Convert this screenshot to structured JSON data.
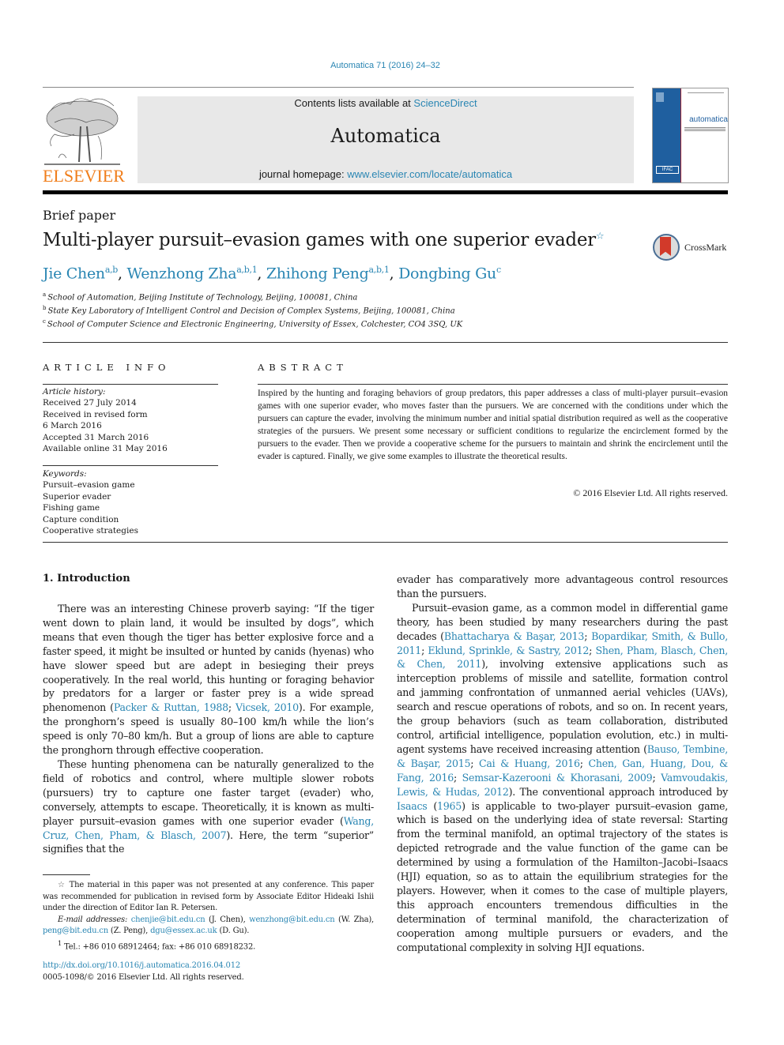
{
  "header": {
    "journal_ref": "Automatica 71 (2016) 24–32",
    "contents_prefix": "Contents lists available at ",
    "contents_link": "ScienceDirect",
    "journal_title": "Automatica",
    "homepage_prefix": "journal homepage: ",
    "homepage_link": "www.elsevier.com/locate/automatica",
    "publisher_logo_text": "ELSEVIER",
    "cover_title": "automatica",
    "cover_badge": "IFAC"
  },
  "article": {
    "type": "Brief paper",
    "title": "Multi-player pursuit–evasion games with one superior evader",
    "title_note_mark": "☆",
    "crossmark_label": "CrossMark",
    "authors": [
      {
        "name": "Jie Chen",
        "sup": "a,b"
      },
      {
        "name": "Wenzhong Zha",
        "sup": "a,b,1"
      },
      {
        "name": "Zhihong Peng",
        "sup": "a,b,1"
      },
      {
        "name": "Dongbing Gu",
        "sup": "c"
      }
    ],
    "affiliations": [
      {
        "mark": "a",
        "text": "School of Automation, Beijing Institute of Technology, Beijing, 100081, China"
      },
      {
        "mark": "b",
        "text": "State Key Laboratory of Intelligent Control and Decision of Complex Systems, Beijing, 100081, China"
      },
      {
        "mark": "c",
        "text": "School of Computer Science and Electronic Engineering, University of Essex, Colchester, CO4 3SQ, UK"
      }
    ]
  },
  "article_info": {
    "heading": "ARTICLE INFO",
    "history_label": "Article history:",
    "history": [
      "Received 27 July 2014",
      "Received in revised form",
      "6 March 2016",
      "Accepted 31 March 2016",
      "Available online 31 May 2016"
    ],
    "keywords_label": "Keywords:",
    "keywords": [
      "Pursuit–evasion game",
      "Superior evader",
      "Fishing game",
      "Capture condition",
      "Cooperative strategies"
    ]
  },
  "abstract": {
    "heading": "ABSTRACT",
    "text": "Inspired by the hunting and foraging behaviors of group predators, this paper addresses a class of multi-player pursuit–evasion games with one superior evader, who moves faster than the pursuers. We are concerned with the conditions under which the pursuers can capture the evader, involving the minimum number and initial spatial distribution required as well as the cooperative strategies of the pursuers. We present some necessary or sufficient conditions to regularize the encirclement formed by the pursuers to the evader. Then we provide a cooperative scheme for the pursuers to maintain and shrink the encirclement until the evader is captured. Finally, we give some examples to illustrate the theoretical results.",
    "copyright": "© 2016 Elsevier Ltd. All rights reserved."
  },
  "body": {
    "section_heading": "1.  Introduction",
    "left": {
      "p1_a": "There was an interesting Chinese proverb saying: “If the tiger went down to plain land, it would be insulted by dogs”, which means that even though the tiger has better explosive force and a faster speed, it might be insulted or hunted by canids (hyenas) who have slower speed but are adept in besieging their preys cooperatively. In the real world, this hunting or foraging behavior by predators for a larger or faster prey is a wide spread phenomenon (",
      "p1_cite1": "Packer & Ruttan, 1988",
      "p1_sep": "; ",
      "p1_cite2": "Vicsek, 2010",
      "p1_b": "). For example, the pronghorn’s speed is usually 80–100 km/h while the lion’s speed is only 70–80 km/h. But a group of lions are able to capture the pronghorn through effective cooperation.",
      "p2_a": "These hunting phenomena can be naturally generalized to the field of robotics and control, where multiple slower robots (pursuers) try to capture one faster target (evader) who, conversely, attempts to escape. Theoretically, it is known as multi-player pursuit–evasion games with one superior evader (",
      "p2_cite": "Wang, Cruz, Chen, Pham, & Blasch, 2007",
      "p2_b": "). Here, the term “superior” signifies that the"
    },
    "right": {
      "p0": "evader has comparatively more advantageous control resources than the pursuers.",
      "p1_a": "Pursuit–evasion game, as a common model in differential game theory, has been studied by many researchers during the past decades (",
      "c1": "Bhattacharya & Başar, 2013",
      "c2": "Bopardikar, Smith, & Bullo, 2011",
      "c3": "Eklund, Sprinkle, & Sastry, 2012",
      "c4": "Shen, Pham, Blasch, Chen, & Chen, 2011",
      "p1_b": "), involving extensive applications such as interception problems of missile and satellite, formation control and jamming confrontation of unmanned aerial vehicles (UAVs), search and rescue operations of robots, and so on. In recent years, the group behaviors (such as team collaboration, distributed control, artificial intelligence, population evolution, etc.) in multi-agent systems have received increasing attention (",
      "c5": "Bauso, Tembine, & Başar, 2015",
      "c6": "Cai & Huang, 2016",
      "c7": "Chen, Gan, Huang, Dou, & Fang, 2016",
      "c8": "Semsar-Kazerooni & Khorasani, 2009",
      "c9": "Vamvoudakis, Lewis, & Hudas, 2012",
      "p1_c": "). The conventional approach introduced by ",
      "c10": "Isaacs",
      "c10_open": " (",
      "c10_year": "1965",
      "p1_d": ") is applicable to two-player pursuit–evasion game, which is based on the underlying idea of state reversal: Starting from the terminal manifold, an optimal trajectory of the states is depicted retrograde and the value function of the game can be determined by using a formulation of the Hamilton–Jacobi–Isaacs (HJI) equation, so as to attain the equilibrium strategies for the players. However, when it comes to the case of multiple players, this approach encounters tremendous difficulties in the determination of terminal manifold, the characterization of cooperation among multiple pursuers or evaders, and the computational complexity in solving HJI equations.",
      "sep": "; "
    }
  },
  "footnotes": {
    "star_mark": "☆",
    "star_text": " The material in this paper was not presented at any conference. This paper was recommended for publication in revised form by Associate Editor Hideaki Ishii under the direction of Editor Ian R. Petersen.",
    "email_label": "E-mail addresses: ",
    "emails": [
      {
        "addr": "chenjie@bit.edu.cn",
        "who": " (J. Chen), "
      },
      {
        "addr": "wenzhong@bit.edu.cn",
        "who": " (W. Zha), "
      },
      {
        "addr": "peng@bit.edu.cn",
        "who": " (Z. Peng), "
      },
      {
        "addr": "dgu@essex.ac.uk",
        "who": " (D. Gu)."
      }
    ],
    "one_mark": "1",
    "one_text": "  Tel.: +86 010 68912464; fax: +86 010 68918232.",
    "doi": "http://dx.doi.org/10.1016/j.automatica.2016.04.012",
    "issn": "0005-1098/© 2016 Elsevier Ltd. All rights reserved."
  }
}
